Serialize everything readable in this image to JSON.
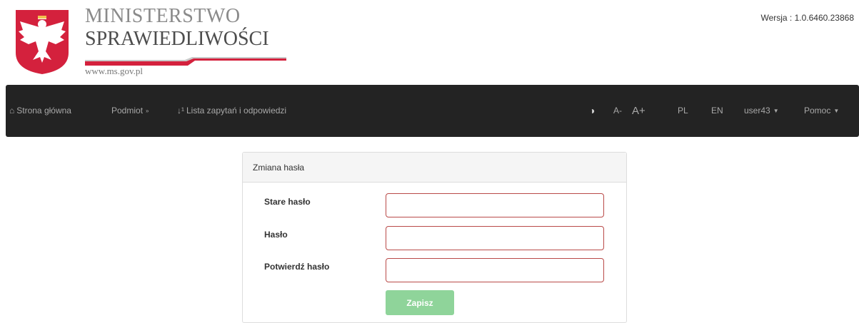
{
  "header": {
    "logo_line1": "MINISTERSTWO",
    "logo_line2": "SPRAWIEDLIWOŚCI",
    "logo_url": "www.ms.gov.pl",
    "version": "Wersja : 1.0.6460.23868"
  },
  "navbar": {
    "home": {
      "icon": "home-icon",
      "label": "Strona główna"
    },
    "subject": {
      "label": "Podmiot",
      "icon": "double-chevron-down-icon"
    },
    "qa_list": {
      "icon": "sort-numeric-icon",
      "label": "Lista zapytań i odpowiedzi"
    },
    "contrast": {
      "icon": "contrast-icon"
    },
    "font_decrease": "A-",
    "font_increase": "A+",
    "lang_pl": "PL",
    "lang_en": "EN",
    "user": "user43",
    "help": "Pomoc"
  },
  "panel": {
    "title": "Zmiana hasła",
    "fields": [
      {
        "label": "Stare hasło",
        "value": ""
      },
      {
        "label": "Hasło",
        "value": ""
      },
      {
        "label": "Potwierdź hasło",
        "value": ""
      }
    ],
    "save_label": "Zapisz"
  },
  "colors": {
    "navbar_bg": "#232323",
    "input_error_border": "#b94a48",
    "save_button": "#8fd49a",
    "emblem_red": "#d4213d"
  }
}
